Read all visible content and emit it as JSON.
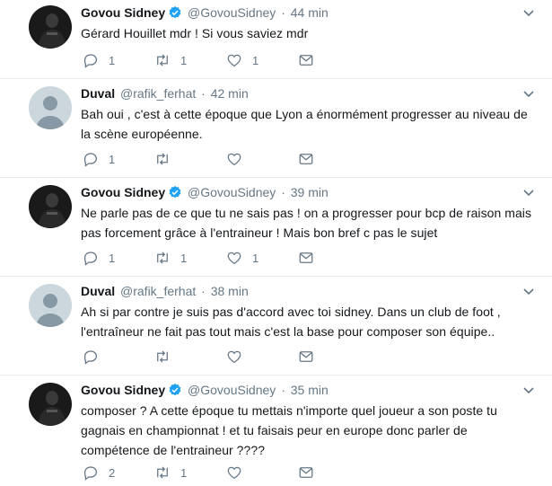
{
  "colors": {
    "verified": "#1da1f2",
    "icon": "#657786",
    "text": "#14171a",
    "muted": "#657786",
    "divider": "#e6ecf0"
  },
  "tweets": [
    {
      "name": "Govou Sidney",
      "verified": true,
      "handle": "@GovouSidney",
      "sep": "·",
      "time": "44 min",
      "text": "Gérard Houillet mdr ! Si vous saviez mdr",
      "replies": "1",
      "retweets": "1",
      "likes": "1",
      "avatar": "dark-photo"
    },
    {
      "name": "Duval",
      "verified": false,
      "handle": "@rafik_ferhat",
      "sep": "·",
      "time": "42 min",
      "text": "Bah oui , c'est à cette époque que Lyon a énormément progresser au niveau de\nla scène européenne.",
      "replies": "1",
      "retweets": "",
      "likes": "",
      "avatar": "default-egg"
    },
    {
      "name": "Govou Sidney",
      "verified": true,
      "handle": "@GovouSidney",
      "sep": "·",
      "time": "39 min",
      "text": "Ne parle pas de ce que tu ne sais pas ! on a progresser pour bcp de raison mais\npas forcement grâce à l'entraineur ! Mais bon bref c pas le sujet",
      "replies": "1",
      "retweets": "1",
      "likes": "1",
      "avatar": "dark-photo"
    },
    {
      "name": "Duval",
      "verified": false,
      "handle": "@rafik_ferhat",
      "sep": "·",
      "time": "38 min",
      "text": "Ah si par contre je suis pas d'accord avec toi sidney. Dans un club de foot ,\nl'entraîneur ne fait pas tout mais c'est la base pour composer son équipe..",
      "replies": "",
      "retweets": "",
      "likes": "",
      "avatar": "default-egg"
    },
    {
      "name": "Govou Sidney",
      "verified": true,
      "handle": "@GovouSidney",
      "sep": "·",
      "time": "35 min",
      "text": "composer ? A cette époque tu mettais n'importe quel joueur a son poste tu\ngagnais en championnat ! et tu faisais peur en europe donc parler de\ncompétence de l'entraineur ????",
      "replies": "2",
      "retweets": "1",
      "likes": "",
      "avatar": "dark-photo"
    }
  ]
}
